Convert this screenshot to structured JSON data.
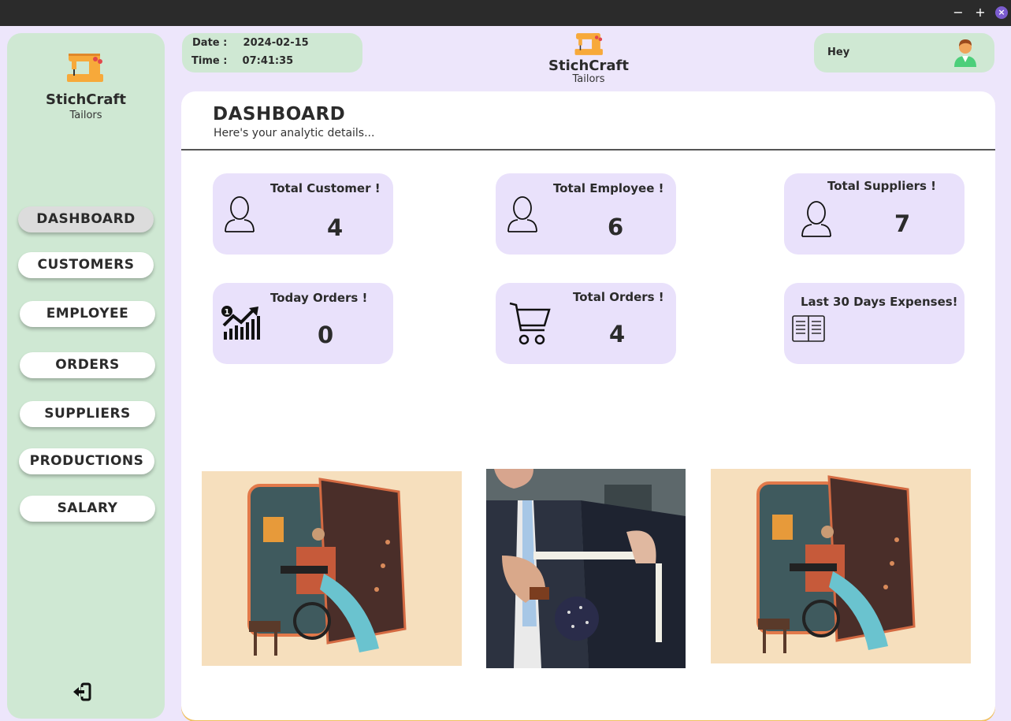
{
  "window": {
    "minimize": "−",
    "maximize": "+",
    "close": "×"
  },
  "brand": {
    "name": "StichCraft",
    "subtitle": "Tailors"
  },
  "datetime": {
    "date_label": "Date :",
    "date_value": "2024-02-15",
    "time_label": "Time :",
    "time_value": "07:41:35"
  },
  "greeting": {
    "text": "Hey",
    "icon": "user-avatar-icon"
  },
  "sidebar": {
    "items": [
      {
        "label": "DASHBOARD",
        "active": true
      },
      {
        "label": "CUSTOMERS",
        "active": false
      },
      {
        "label": "EMPLOYEE",
        "active": false
      },
      {
        "label": "ORDERS",
        "active": false
      },
      {
        "label": "SUPPLIERS",
        "active": false
      },
      {
        "label": "PRODUCTIONS",
        "active": false
      },
      {
        "label": "SALARY",
        "active": false
      }
    ],
    "logout_icon": "logout-icon"
  },
  "dashboard": {
    "title": "DASHBOARD",
    "subtitle": "Here's your analytic details..."
  },
  "cards": [
    {
      "title": "Total Customer !",
      "value": "4",
      "icon": "person-outline-icon"
    },
    {
      "title": "Total Employee !",
      "value": "6",
      "icon": "person-outline-icon"
    },
    {
      "title": "Total Suppliers !",
      "value": "7",
      "icon": "person-outline-icon"
    },
    {
      "title": "Today Orders !",
      "value": "0",
      "icon": "growth-chart-icon"
    },
    {
      "title": "Total Orders !",
      "value": "4",
      "icon": "shopping-cart-icon"
    },
    {
      "title": "Last 30 Days Expenses!",
      "value": "",
      "icon": "ledger-book-icon"
    }
  ],
  "images": [
    "tailor-illustration",
    "suit-measurement-photo",
    "tailor-illustration"
  ],
  "colors": {
    "page_bg": "#ede6fb",
    "sidebar_bg": "#cfe8d3",
    "card_bg": "#e9e1fb",
    "accent": "#f0c060"
  }
}
